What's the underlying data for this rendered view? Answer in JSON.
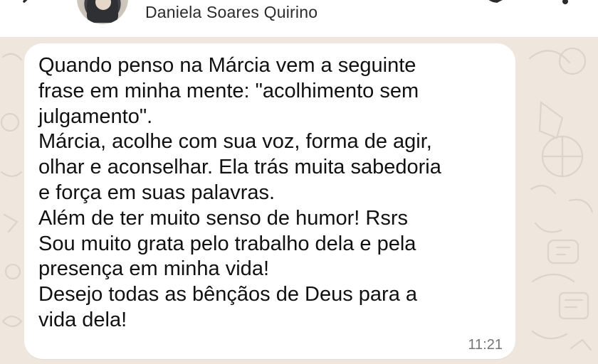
{
  "header": {
    "contact_name": "Daniela Soares Quirino",
    "back_icon": "arrow-left-icon",
    "call_icon": "phone-icon",
    "menu_icon": "more-vertical-icon"
  },
  "message": {
    "lines": [
      "Quando penso na Márcia vem a seguinte",
      "frase em minha mente: \"acolhimento sem",
      "julgamento\".",
      "Márcia, acolhe com sua voz, forma de agir,",
      "olhar e aconselhar. Ela trás muita sabedoria",
      "e força em suas palavras.",
      "Além de ter muito senso de humor! Rsrs",
      "Sou muito grata pelo trabalho dela e pela",
      "presença em minha vida!",
      "Desejo todas as bênçãos de Deus para a",
      "vida dela!"
    ],
    "time": "11:21"
  },
  "colors": {
    "header_bg": "#ffffff",
    "wallpaper": "#efe7de",
    "bubble_bg": "#ffffff",
    "text": "#111111",
    "time_text": "#757575"
  }
}
